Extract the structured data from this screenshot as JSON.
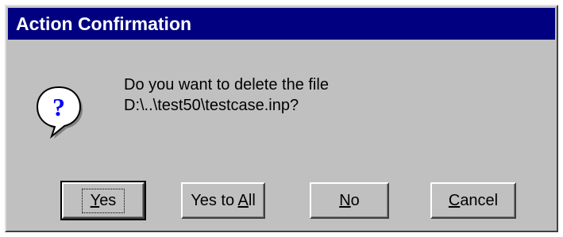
{
  "dialog": {
    "title": "Action Confirmation",
    "icon": "question-icon",
    "message_line1": "Do you want to delete the file",
    "message_line2": "D:\\..\\test50\\testcase.inp?"
  },
  "buttons": {
    "yes": {
      "mnemonic": "Y",
      "rest": "es"
    },
    "yes_to_all": {
      "pre": "Yes to ",
      "mnemonic": "A",
      "rest": "ll"
    },
    "no": {
      "mnemonic": "N",
      "rest": "o"
    },
    "cancel": {
      "mnemonic": "C",
      "rest": "ancel"
    }
  },
  "colors": {
    "titlebar": "#000080",
    "face": "#c0c0c0",
    "icon_bubble": "#ffffff",
    "icon_mark": "#0000ff"
  }
}
